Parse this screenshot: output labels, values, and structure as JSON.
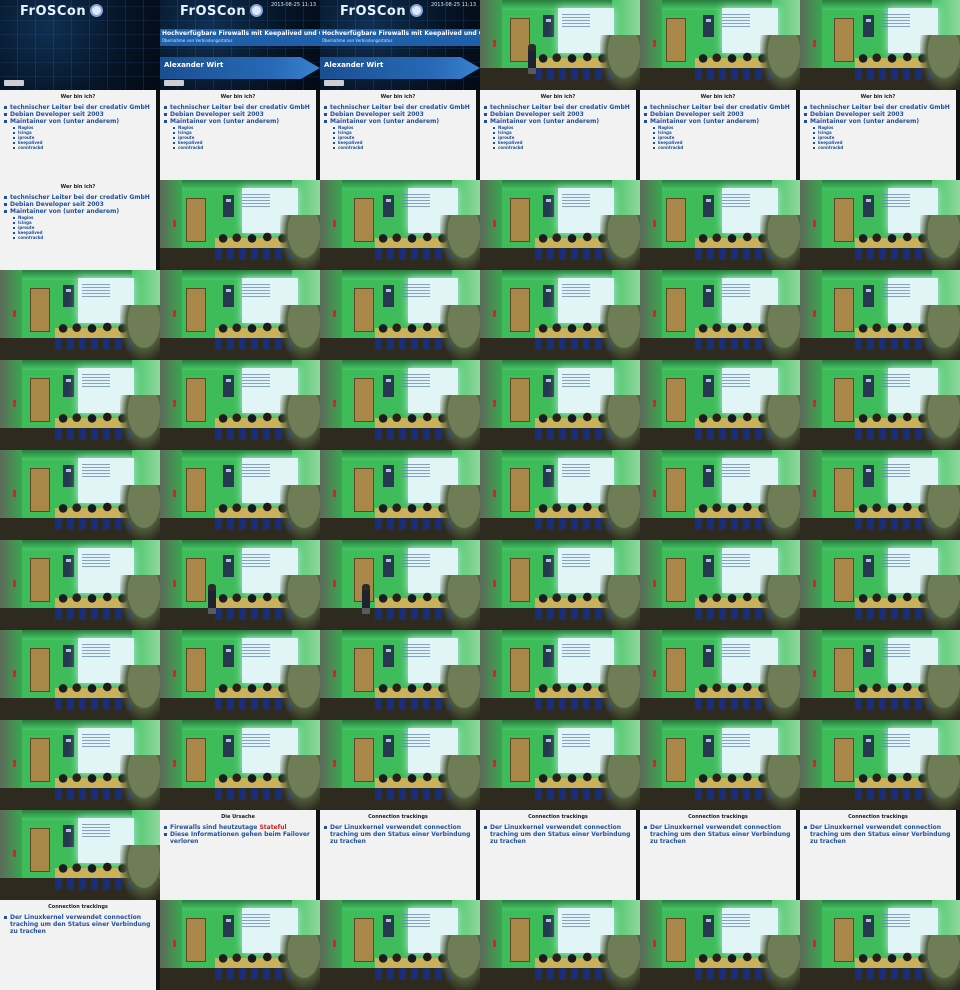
{
  "grid": {
    "columns": 6,
    "rows": 11
  },
  "title_slide": {
    "logo": "FrOSCon",
    "date": "2013-08-25 11:13",
    "title": "Hochverfügbare Firewalls mit Keepalived und Conntrackd",
    "subtitle": "Übernahme von Verbindungsstatus",
    "author": "Alexander Wirt"
  },
  "slides": {
    "wer_bin_ich": {
      "heading": "Wer bin ich?",
      "bullets": [
        "technischer Leiter bei der credativ GmbH",
        "Debian Developer seit 2003",
        "Maintainer von (unter anderem)"
      ],
      "sub_bullets": [
        "Nagios",
        "Icinga",
        "iproute",
        "keepalived",
        "conntrackd"
      ]
    },
    "die_ursache": {
      "heading": "Die Ursache",
      "bullet1_prefix": "Firewalls sind heutzutage ",
      "bullet1_highlight": "Stateful",
      "bullet2": "Diese Informationen gehen beim Failover verloren"
    },
    "connection_tracking": {
      "heading": "Connection trackings",
      "bullet": "Der Linuxkernel verwendet connection traching um den Status einer Verbindung zu trachen"
    }
  },
  "tiles": [
    "title-plain",
    "title",
    "title",
    "room-speaker",
    "room",
    "room",
    "wer",
    "wer",
    "wer",
    "wer",
    "wer",
    "wer",
    "wer-short",
    "room",
    "room",
    "room",
    "room",
    "room",
    "room",
    "room",
    "room",
    "room",
    "room",
    "room",
    "room",
    "room",
    "room",
    "room",
    "room",
    "room",
    "room",
    "room",
    "room",
    "room",
    "room",
    "room",
    "room",
    "room-speaker",
    "room-speaker",
    "room",
    "room",
    "room",
    "room",
    "room",
    "room",
    "room",
    "room",
    "room",
    "room",
    "room",
    "room",
    "room",
    "room",
    "room",
    "room",
    "ursache",
    "conn",
    "conn",
    "conn",
    "conn",
    "conn-short",
    "room",
    "room",
    "room",
    "room",
    "room"
  ],
  "colors": {
    "slide_text": "#1f4f9b",
    "highlight": "#d0201a",
    "room_green": "#3fbc5a",
    "title_band": "#1d5fa8"
  }
}
